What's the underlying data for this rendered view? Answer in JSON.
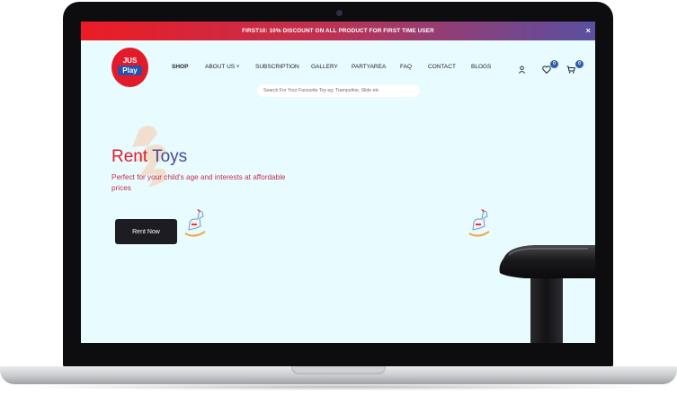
{
  "promo": {
    "text": "FIRST10: 10% DISCOUNT ON ALL PRODUCT FOR FIRST TIME USER",
    "close": "×"
  },
  "logo": {
    "top": "JUS",
    "bottom": "Play"
  },
  "nav": {
    "items": [
      "SHOP",
      "ABOUT US",
      "SUBSCRIPTION",
      "GALLERY",
      "PARTYAREA",
      "FAQ",
      "CONTACT",
      "BLOGS"
    ],
    "about_caret": "˅"
  },
  "header_icons": {
    "user": "user-icon",
    "wishlist": "heart-icon",
    "cart": "cart-icon",
    "wishlist_count": "0",
    "cart_count": "0"
  },
  "search": {
    "placeholder": "Search For Your Favourite Toy eg: Trampoline, Slide etc",
    "value": ""
  },
  "hero": {
    "title_part1": "Rent ",
    "title_part2": "Toys",
    "subtitle": "Perfect for your child's age and interests at affordable prices",
    "cta_label": "Rent Now"
  },
  "colors": {
    "promo_start": "#ec1c24",
    "promo_end": "#5a4fa1",
    "accent_red": "#e21b2a",
    "accent_purple": "#4a4896",
    "background": "#e8fbff",
    "button": "#1c1c22"
  }
}
